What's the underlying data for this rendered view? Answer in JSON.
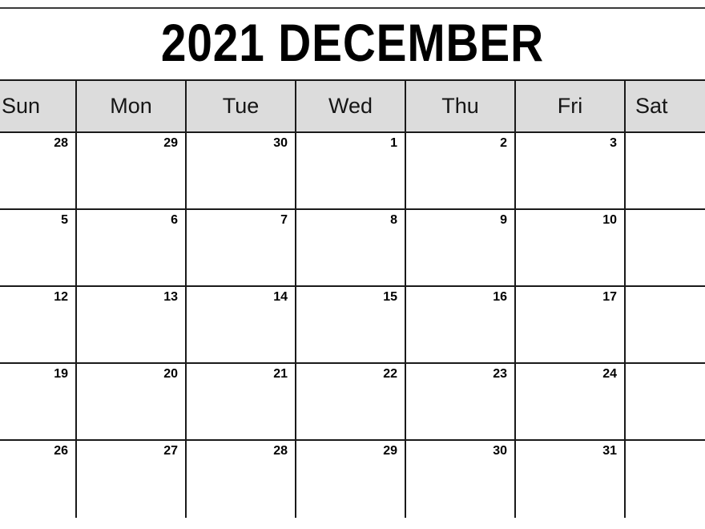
{
  "calendar": {
    "title": "2021 DECEMBER",
    "year": "2021",
    "month": "DECEMBER",
    "colors": {
      "header_background": "#dcdcdc",
      "grid_line": "#1a1a1a",
      "page_background": "#ffffff",
      "text": "#000000"
    },
    "weekdays": [
      {
        "label": "Sun"
      },
      {
        "label": "Mon"
      },
      {
        "label": "Tue"
      },
      {
        "label": "Wed"
      },
      {
        "label": "Thu"
      },
      {
        "label": "Fri"
      },
      {
        "label": "Sat"
      }
    ],
    "weeks": [
      {
        "days": [
          {
            "number": "28"
          },
          {
            "number": "29"
          },
          {
            "number": "30"
          },
          {
            "number": "1"
          },
          {
            "number": "2"
          },
          {
            "number": "3"
          },
          {
            "number": ""
          }
        ]
      },
      {
        "days": [
          {
            "number": "5"
          },
          {
            "number": "6"
          },
          {
            "number": "7"
          },
          {
            "number": "8"
          },
          {
            "number": "9"
          },
          {
            "number": "10"
          },
          {
            "number": ""
          }
        ]
      },
      {
        "days": [
          {
            "number": "12"
          },
          {
            "number": "13"
          },
          {
            "number": "14"
          },
          {
            "number": "15"
          },
          {
            "number": "16"
          },
          {
            "number": "17"
          },
          {
            "number": ""
          }
        ]
      },
      {
        "days": [
          {
            "number": "19"
          },
          {
            "number": "20"
          },
          {
            "number": "21"
          },
          {
            "number": "22"
          },
          {
            "number": "23"
          },
          {
            "number": "24"
          },
          {
            "number": ""
          }
        ]
      },
      {
        "days": [
          {
            "number": "26"
          },
          {
            "number": "27"
          },
          {
            "number": "28"
          },
          {
            "number": "29"
          },
          {
            "number": "30"
          },
          {
            "number": "31"
          },
          {
            "number": ""
          }
        ]
      }
    ]
  }
}
